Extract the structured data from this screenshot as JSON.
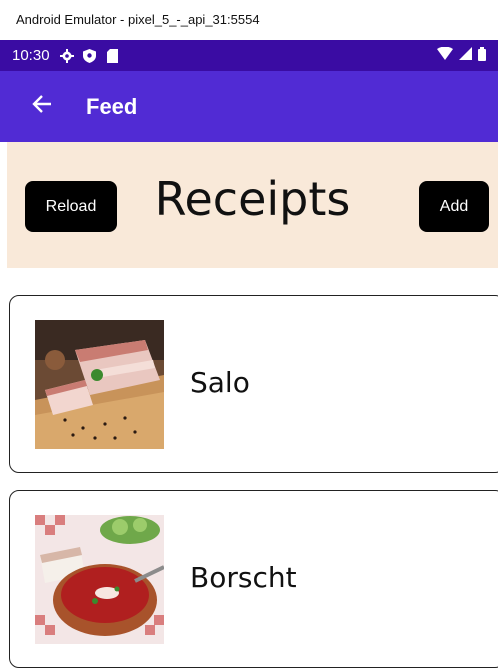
{
  "window": {
    "title": "Android Emulator - pixel_5_-_api_31:5554"
  },
  "status_bar": {
    "time": "10:30",
    "icons": [
      "gear-icon",
      "shield-icon",
      "sd-card-icon"
    ],
    "right_icons": [
      "wifi-icon",
      "signal-icon",
      "battery-icon"
    ]
  },
  "app_bar": {
    "title": "Feed",
    "back_icon": "arrow-back-icon",
    "color": "#512bd4"
  },
  "header": {
    "title": "Receipts",
    "reload_label": "Reload",
    "add_label": "Add",
    "background": "#f9e9d9"
  },
  "recipes": [
    {
      "name": "Salo",
      "image": "salo-photo"
    },
    {
      "name": "Borscht",
      "image": "borscht-photo"
    }
  ]
}
